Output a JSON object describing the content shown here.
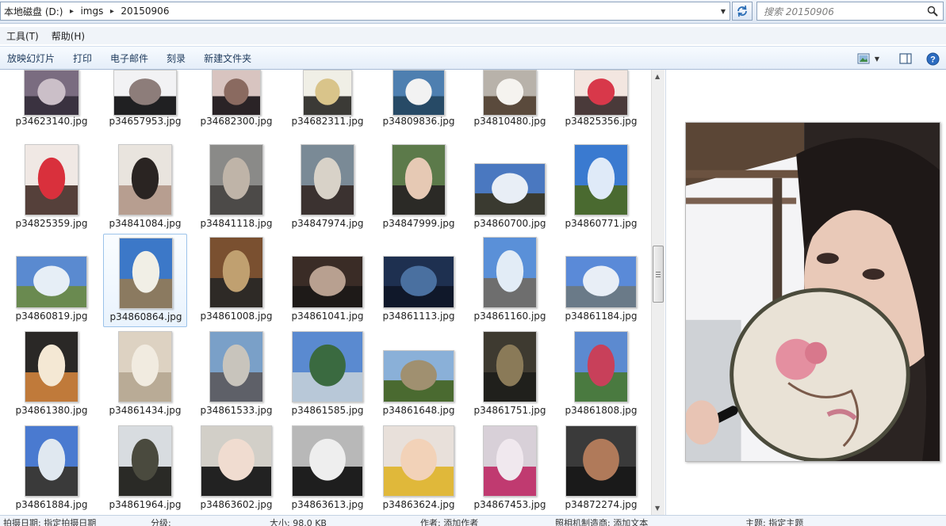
{
  "address_bar": {
    "crumbs": [
      "本地磁盘 (D:)",
      "imgs",
      "20150906"
    ]
  },
  "search": {
    "placeholder": "搜索 20150906"
  },
  "menu": {
    "items": [
      "工具(T)",
      "帮助(H)"
    ]
  },
  "commands": {
    "items": [
      "放映幻灯片",
      "打印",
      "电子邮件",
      "刻录",
      "新建文件夹"
    ]
  },
  "files": [
    "p34623140.jpg",
    "p34657953.jpg",
    "p34682300.jpg",
    "p34682311.jpg",
    "p34809836.jpg",
    "p34810480.jpg",
    "p34825356.jpg",
    "p34825359.jpg",
    "p34841084.jpg",
    "p34841118.jpg",
    "p34847974.jpg",
    "p34847999.jpg",
    "p34860700.jpg",
    "p34860771.jpg",
    "p34860819.jpg",
    "p34860864.jpg",
    "p34861008.jpg",
    "p34861041.jpg",
    "p34861113.jpg",
    "p34861160.jpg",
    "p34861184.jpg",
    "p34861380.jpg",
    "p34861434.jpg",
    "p34861533.jpg",
    "p34861585.jpg",
    "p34861648.jpg",
    "p34861751.jpg",
    "p34861808.jpg",
    "p34861884.jpg",
    "p34861964.jpg",
    "p34863602.jpg",
    "p34863613.jpg",
    "p34863624.jpg",
    "p34867453.jpg",
    "p34872274.jpg"
  ],
  "selected_file": "p34860864.jpg",
  "status": {
    "fields": [
      "拍摄日期: 指定拍摄日期",
      "分级:",
      "大小: 98.0 KB",
      "作者: 添加作者",
      "照相机制造商: 添加文本",
      "主题: 指定主题"
    ]
  },
  "colors": {
    "selection_border": "#9cc3ea",
    "command_text": "#1e3a5c",
    "chrome_bg": "#dfe8f4"
  }
}
